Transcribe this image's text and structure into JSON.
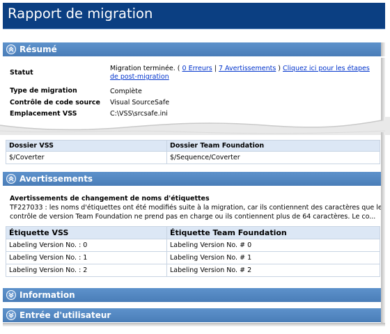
{
  "header": {
    "title": "Rapport de migration"
  },
  "summary": {
    "section_title": "Résumé",
    "statut_label": "Statut",
    "statut_prefix": "Migration terminée. ( ",
    "errors_link": "0 Erreurs",
    "sep": " | ",
    "warnings_link": "7 Avertissements",
    "close_paren": " ) ",
    "postmig_link": "Cliquez ici pour les étapes",
    "postmig_link2": "de post-migration",
    "type_label": "Type de migration",
    "type_value": "Complète",
    "scc_label": "Contrôle de code source",
    "scc_value": "Visual SourceSafe",
    "vss_loc_label": "Emplacement VSS",
    "vss_loc_value": "C:\\VSS\\srcsafe.ini"
  },
  "folders": {
    "col1": "Dossier VSS",
    "col2": "Dossier Team Foundation",
    "rows": [
      [
        "$/Coverter",
        "$/Sequence/Coverter"
      ]
    ]
  },
  "warnings": {
    "section_title": "Avertissements",
    "subtitle": "Avertissements de changement de noms d'étiquettes",
    "text1": "TF227033 : les noms d'étiquettes ont été modifiés suite à la migration, car ils contiennent des caractères que le",
    "text2": "contrôle de version Team Foundation ne prend pas en charge ou ils contiennent plus de 64 caractères. Le co...",
    "col1": "Étiquette VSS",
    "col2": "Étiquette Team Foundation",
    "rows": [
      [
        "Labeling Version No. : 0",
        "Labeling Version No. # 0"
      ],
      [
        "Labeling Version No. : 1",
        "Labeling Version No. # 1"
      ],
      [
        "Labeling Version No. : 2",
        "Labeling Version No. # 2"
      ]
    ]
  },
  "information": {
    "section_title": "Information"
  },
  "user_input": {
    "section_title": "Entrée d'utilisateur"
  },
  "icons": {
    "expanded": "chevron-up-icon",
    "collapsed": "chevron-down-icon"
  },
  "colors": {
    "title_bg": "#0b3f82",
    "section_bg": "#5d92cb",
    "link": "#0033cc"
  }
}
